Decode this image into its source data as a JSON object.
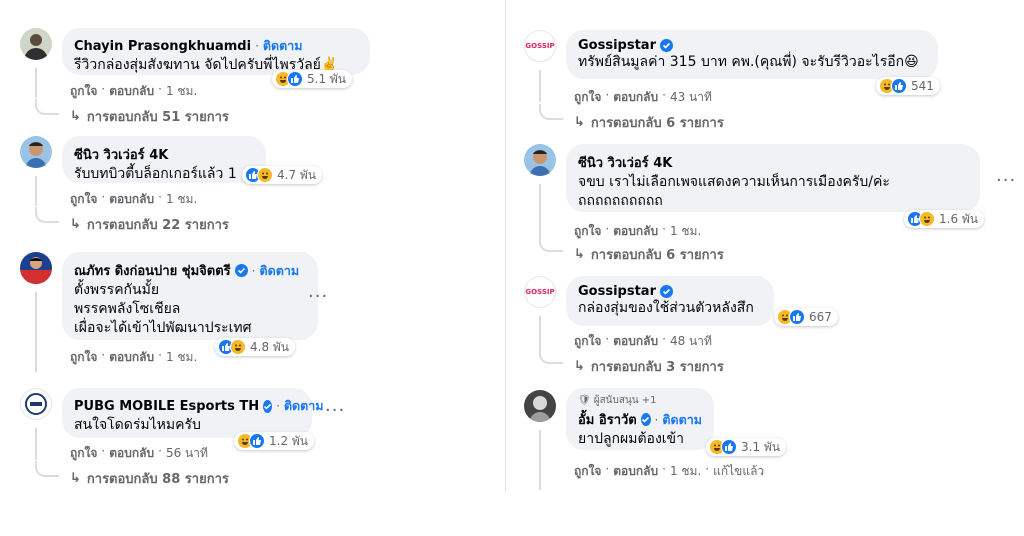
{
  "ui": {
    "follow": "ติดตาม",
    "like": "ถูกใจ",
    "reply": "ตอบกลับ",
    "sep": "·"
  },
  "left": [
    {
      "name": "Chayin Prasongkhuamdi",
      "follow": true,
      "lines": [
        "รีวิวกล่องสุ่มสังฆทาน จัดไปครับพี่ไพรวัลย์✌️"
      ],
      "reactions": {
        "icons": [
          "haha",
          "like"
        ],
        "count": "5.1 พัน"
      },
      "time": "1 ชม.",
      "replies": "การตอบกลับ 51 รายการ"
    },
    {
      "name": "ซีนิว วิวเว่อร์ 4K",
      "follow": false,
      "lines": [
        "รับบทบิวตี้บล็อกเกอร์แล้ว 1"
      ],
      "reactions": {
        "icons": [
          "like",
          "haha"
        ],
        "count": "4.7 พัน"
      },
      "time": "1 ชม.",
      "replies": "การตอบกลับ 22 รายการ"
    },
    {
      "name": "ณภัทร ดิงก่อนบ่าย ชุ่มจิตตรี",
      "verified": true,
      "follow": true,
      "lines": [
        "ตั้งพรรคกันมั้ย",
        "พรรคพลังโซเชียล",
        "เผื่อจะได้เข้าไปพัฒนาประเทศ"
      ],
      "reactions": {
        "icons": [
          "like",
          "haha"
        ],
        "count": "4.8 พัน"
      },
      "time": "1 ชม."
    },
    {
      "name": "PUBG MOBILE Esports TH",
      "verified": true,
      "follow": true,
      "lines": [
        "สนใจโดดร่มไหมครับ"
      ],
      "reactions": {
        "icons": [
          "haha",
          "like"
        ],
        "count": "1.2 พัน"
      },
      "time": "56 นาที",
      "replies": "การตอบกลับ 88 รายการ"
    }
  ],
  "right": [
    {
      "name": "Gossipstar",
      "verified": true,
      "avatar_text": "GOSSIP",
      "lines": [
        "ทรัพย์สินมูลค่า 315 บาท คพ.(คุณพี่) จะรับรีวิวอะไรอีก😆"
      ],
      "reactions": {
        "icons": [
          "haha",
          "like"
        ],
        "count": "541"
      },
      "time": "43 นาที",
      "replies": "การตอบกลับ 6 รายการ"
    },
    {
      "name": "ซีนิว วิวเว่อร์ 4K",
      "lines": [
        "จขบ เราไม่เลือกเพจแสดงความเห็นการเมืองครับ/ค่ะ",
        "ถถถถถถถถถถ"
      ],
      "reactions": {
        "icons": [
          "like",
          "haha"
        ],
        "count": "1.6 พัน"
      },
      "time": "1 ชม.",
      "replies": "การตอบกลับ 6 รายการ"
    },
    {
      "name": "Gossipstar",
      "verified": true,
      "avatar_text": "GOSSIP",
      "lines": [
        "กล่องสุ่มของใช้ส่วนตัวหลังสึก"
      ],
      "reactions": {
        "icons": [
          "haha",
          "like"
        ],
        "count": "667"
      },
      "time": "48 นาที",
      "replies": "การตอบกลับ 3 รายการ"
    },
    {
      "name": "อั้ม อิราวัต",
      "badge": "ผู้สนับสนุน +1",
      "verified": true,
      "follow": true,
      "lines": [
        "ยาปลูกผมต้องเข้า"
      ],
      "reactions": {
        "icons": [
          "haha",
          "like"
        ],
        "count": "3.1 พัน"
      },
      "time": "1 ชม.",
      "edited": "แก้ไขแล้ว"
    }
  ]
}
